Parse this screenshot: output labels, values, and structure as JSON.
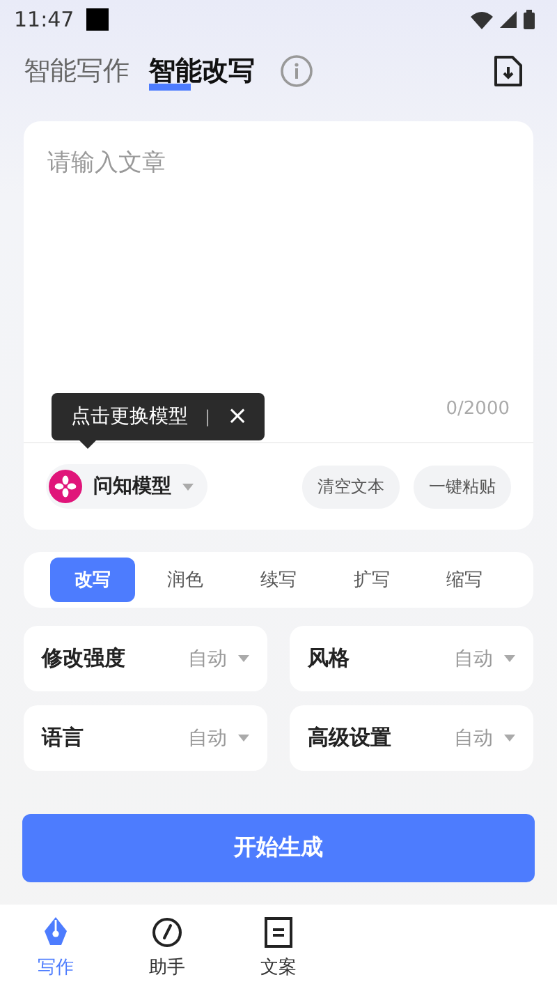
{
  "status_bar": {
    "time": "11:47"
  },
  "header": {
    "tabs": [
      {
        "label": "智能写作",
        "selected": false
      },
      {
        "label": "智能改写",
        "selected": true
      }
    ]
  },
  "editor": {
    "placeholder": "请输入文章",
    "counter": "0/2000",
    "tooltip": {
      "text": "点击更换模型",
      "separator": "|",
      "close": "×"
    },
    "model": "问知模型",
    "actions": [
      "清空文本",
      "一键粘贴"
    ]
  },
  "modes": [
    {
      "label": "改写",
      "selected": true
    },
    {
      "label": "润色",
      "selected": false
    },
    {
      "label": "续写",
      "selected": false
    },
    {
      "label": "扩写",
      "selected": false
    },
    {
      "label": "缩写",
      "selected": false
    }
  ],
  "settings": [
    {
      "label": "修改强度",
      "value": "自动"
    },
    {
      "label": "风格",
      "value": "自动"
    },
    {
      "label": "语言",
      "value": "自动"
    },
    {
      "label": "高级设置",
      "value": "自动"
    }
  ],
  "start_button": "开始生成",
  "bottom_nav": [
    {
      "label": "写作",
      "kind": "pen",
      "selected": true
    },
    {
      "label": "助手",
      "kind": "compass",
      "selected": false
    },
    {
      "label": "文案",
      "kind": "doc",
      "selected": false
    }
  ]
}
